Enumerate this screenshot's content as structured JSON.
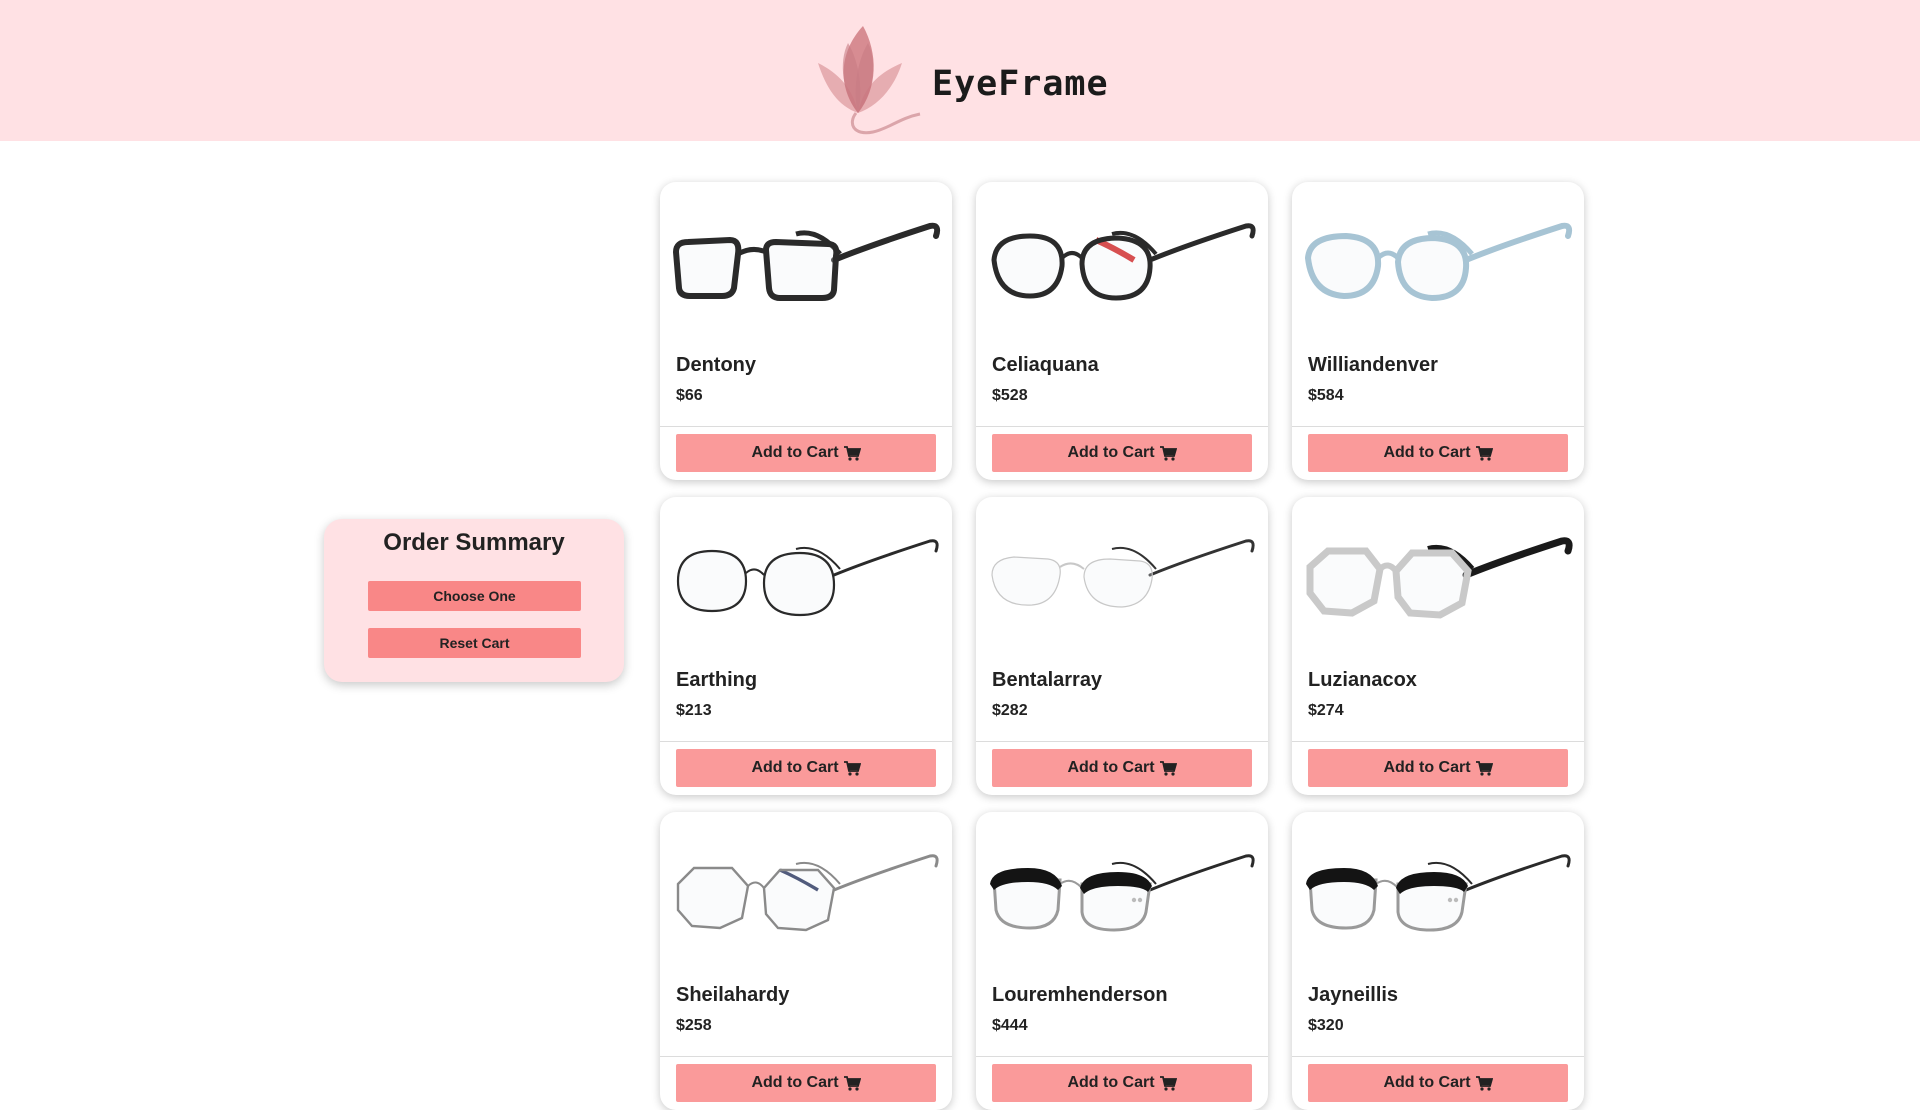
{
  "header": {
    "brand": "EyeFrame",
    "colors": {
      "background": "#ffe1e4",
      "logo_petals": "#d98a8f"
    },
    "logo_icon": "lotus-flower-icon"
  },
  "order_summary": {
    "title": "Order Summary",
    "choose_label": "Choose One",
    "reset_label": "Reset Cart"
  },
  "button_icon": "cart-icon",
  "add_to_cart_label": "Add to Cart",
  "colors": {
    "button": "#fa9a9a",
    "button_text": "#222222"
  },
  "products": [
    {
      "name": "Dentony",
      "price": "$66",
      "style": "rect-black"
    },
    {
      "name": "Celiaquana",
      "price": "$528",
      "style": "round-black-red"
    },
    {
      "name": "Williandenver",
      "price": "$584",
      "style": "round-clear-blue"
    },
    {
      "name": "Earthing",
      "price": "$213",
      "style": "round-wire-black"
    },
    {
      "name": "Bentalarray",
      "price": "$282",
      "style": "rimless"
    },
    {
      "name": "Luzianacox",
      "price": "$274",
      "style": "hex-clear"
    },
    {
      "name": "Sheilahardy",
      "price": "$258",
      "style": "hex-wire-silver"
    },
    {
      "name": "Louremhenderson",
      "price": "$444",
      "style": "clubmaster"
    },
    {
      "name": "Jayneillis",
      "price": "$320",
      "style": "clubmaster"
    }
  ]
}
